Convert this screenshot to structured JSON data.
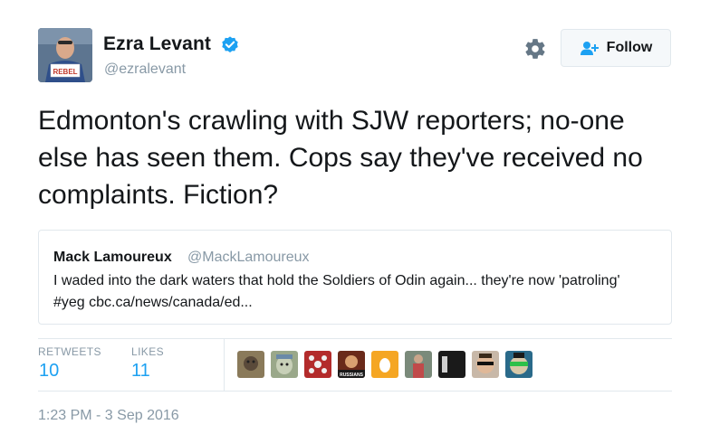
{
  "author": {
    "name": "Ezra Levant",
    "handle": "@ezralevant",
    "avatar_sign_text": "REBEL"
  },
  "follow_button": {
    "label": "Follow"
  },
  "tweet": {
    "text": "Edmonton's crawling with SJW reporters; no-one else has seen them. Cops say they've received no complaints. Fiction?"
  },
  "quoted_tweet": {
    "name": "Mack Lamoureux",
    "handle": "@MackLamoureux",
    "text": "I waded into the dark waters that hold the Soldiers of Odin again... they're now 'patroling' #yeg  cbc.ca/news/canada/ed..."
  },
  "stats": {
    "retweets_label": "RETWEETS",
    "retweets_count": "10",
    "likes_label": "LIKES",
    "likes_count": "11"
  },
  "likers": [
    {
      "icon": "avatar-animal-photo",
      "color": "#8a7a5a"
    },
    {
      "icon": "avatar-cartoon-face",
      "color": "#9aa88a"
    },
    {
      "icon": "avatar-red-pattern",
      "color": "#b32b2b"
    },
    {
      "icon": "avatar-russians",
      "color": "#6a2a1a",
      "text": "RUSSIANS"
    },
    {
      "icon": "avatar-egg",
      "color": "#f5a623"
    },
    {
      "icon": "avatar-figure-photo",
      "color": "#7a8a7a"
    },
    {
      "icon": "avatar-dark-photo",
      "color": "#1a1a1a"
    },
    {
      "icon": "avatar-sunglasses-man",
      "color": "#c8b8a8"
    },
    {
      "icon": "avatar-green-sunglasses",
      "color": "#2a6a8a"
    }
  ],
  "timestamp": "1:23 PM - 3 Sep 2016",
  "colors": {
    "link_blue": "#1da1f2",
    "verified_blue": "#1da1f2",
    "muted_gray": "#8899a6",
    "text": "#14171a",
    "border": "#e1e8ed"
  }
}
